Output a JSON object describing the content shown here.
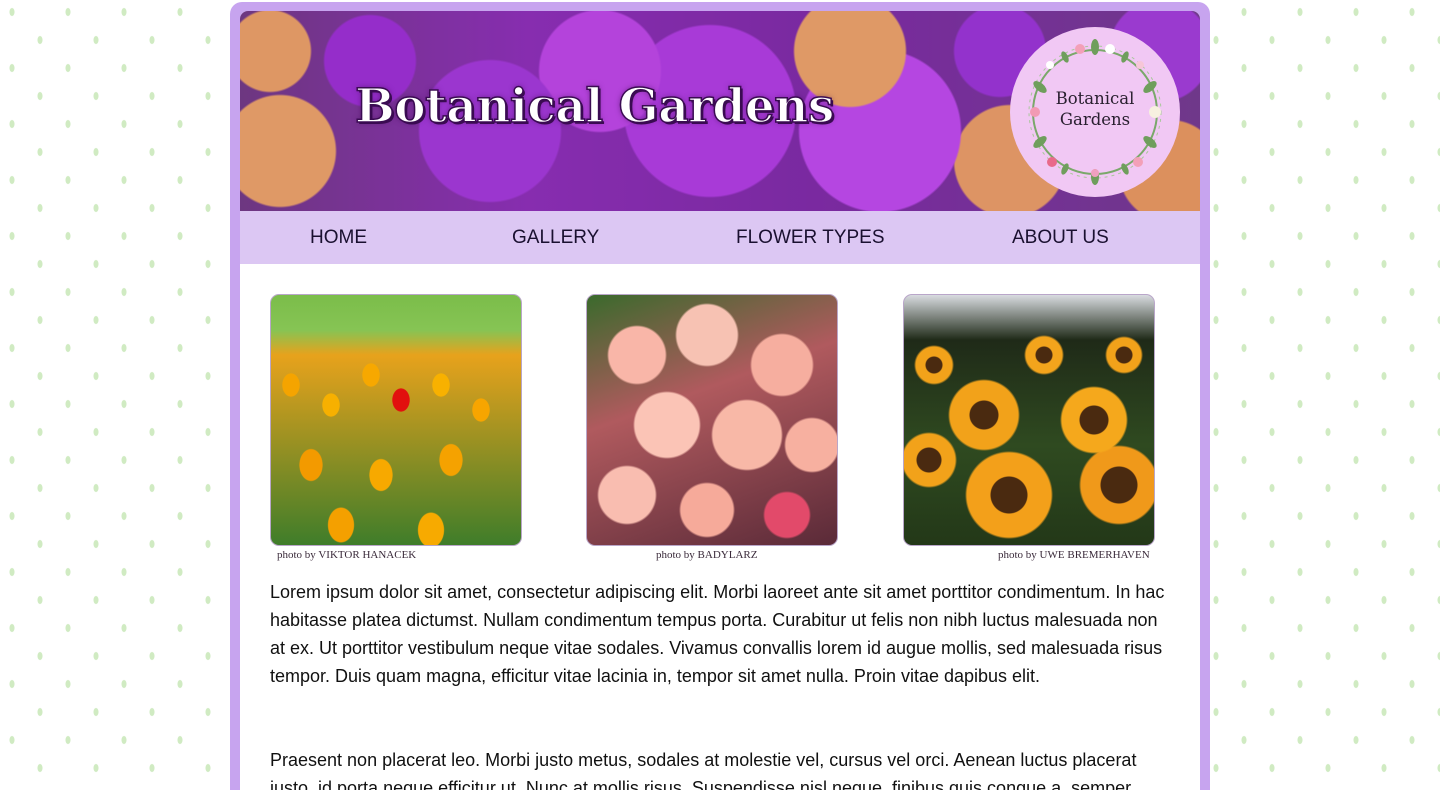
{
  "header": {
    "title": "Botanical Gardens",
    "logo_line1": "Botanical",
    "logo_line2": "Gardens",
    "logo_icon": "floral-wreath-icon"
  },
  "nav": {
    "items": [
      "HOME",
      "GALLERY",
      "FLOWER TYPES",
      "ABOUT US"
    ]
  },
  "gallery": {
    "photos": [
      {
        "subject": "tulips",
        "credit": "photo by VIKTOR HANACEK"
      },
      {
        "subject": "carnations",
        "credit": "photo by BADYLARZ"
      },
      {
        "subject": "sunflowers",
        "credit": "photo by UWE BREMERHAVEN"
      }
    ]
  },
  "content": {
    "paragraph1": "Lorem ipsum dolor sit amet, consectetur adipiscing elit. Morbi laoreet ante sit amet porttitor condimentum. In hac habitasse platea dictumst. Nullam condimentum tempus porta. Curabitur ut felis non nibh luctus malesuada non at ex. Ut porttitor vestibulum neque vitae sodales. Vivamus convallis lorem id augue mollis, sed malesuada risus tempor. Duis quam magna, efficitur vitae lacinia in, tempor sit amet nulla. Proin vitae dapibus elit.",
    "paragraph2": "Praesent non placerat leo. Morbi justo metus, sodales at molestie vel, cursus vel orci. Aenean luctus placerat justo, id porta neque efficitur ut. Nunc at mollis risus. Suspendisse nisl neque, finibus quis congue a, semper"
  },
  "colors": {
    "frame": "#c7a4ef",
    "nav_background": "#dcc7f3",
    "logo_badge": "#f1c8f4",
    "page_background": "#ffffff"
  }
}
